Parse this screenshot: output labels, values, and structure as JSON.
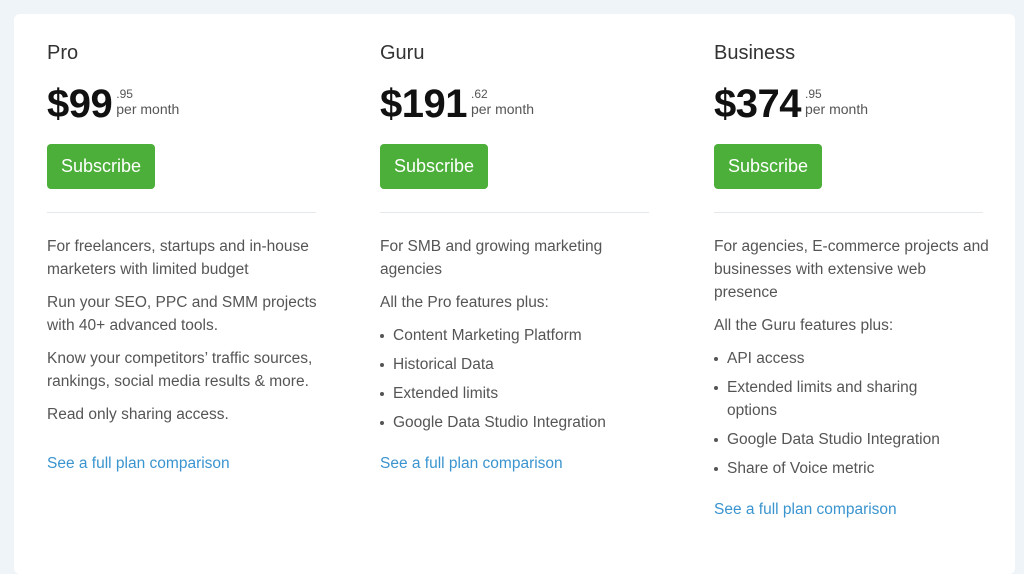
{
  "plans": [
    {
      "name": "Pro",
      "price_whole": "$99",
      "price_cents": ".95",
      "period": "per month",
      "subscribe_label": "Subscribe",
      "paragraphs": [
        "For freelancers, startups and in-house marketers with limited budget",
        "Run your SEO, PPC and SMM projects with 40+ advanced tools.",
        "Know your competitors’ traffic sources, rankings, social media results & more.",
        "Read only sharing access."
      ],
      "features": [],
      "compare_link": "See a full plan comparison"
    },
    {
      "name": "Guru",
      "price_whole": "$191",
      "price_cents": ".62",
      "period": "per month",
      "subscribe_label": "Subscribe",
      "paragraphs": [
        "For SMB and growing marketing agencies",
        "All the Pro features plus:"
      ],
      "features": [
        "Content Marketing Platform",
        "Historical Data",
        "Extended limits",
        "Google Data Studio Integration"
      ],
      "compare_link": "See a full plan comparison"
    },
    {
      "name": "Business",
      "price_whole": "$374",
      "price_cents": ".95",
      "period": "per month",
      "subscribe_label": "Subscribe",
      "paragraphs": [
        "For agencies, E-commerce projects and businesses with extensive web presence",
        "All the Guru features plus:"
      ],
      "features": [
        "API access",
        "Extended limits and sharing options",
        "Google Data Studio Integration",
        "Share of Voice metric"
      ],
      "compare_link": "See a full plan comparison"
    }
  ],
  "colors": {
    "subscribe_button": "#4caf39",
    "link": "#3a94cf",
    "page_background": "#eef4f8"
  }
}
